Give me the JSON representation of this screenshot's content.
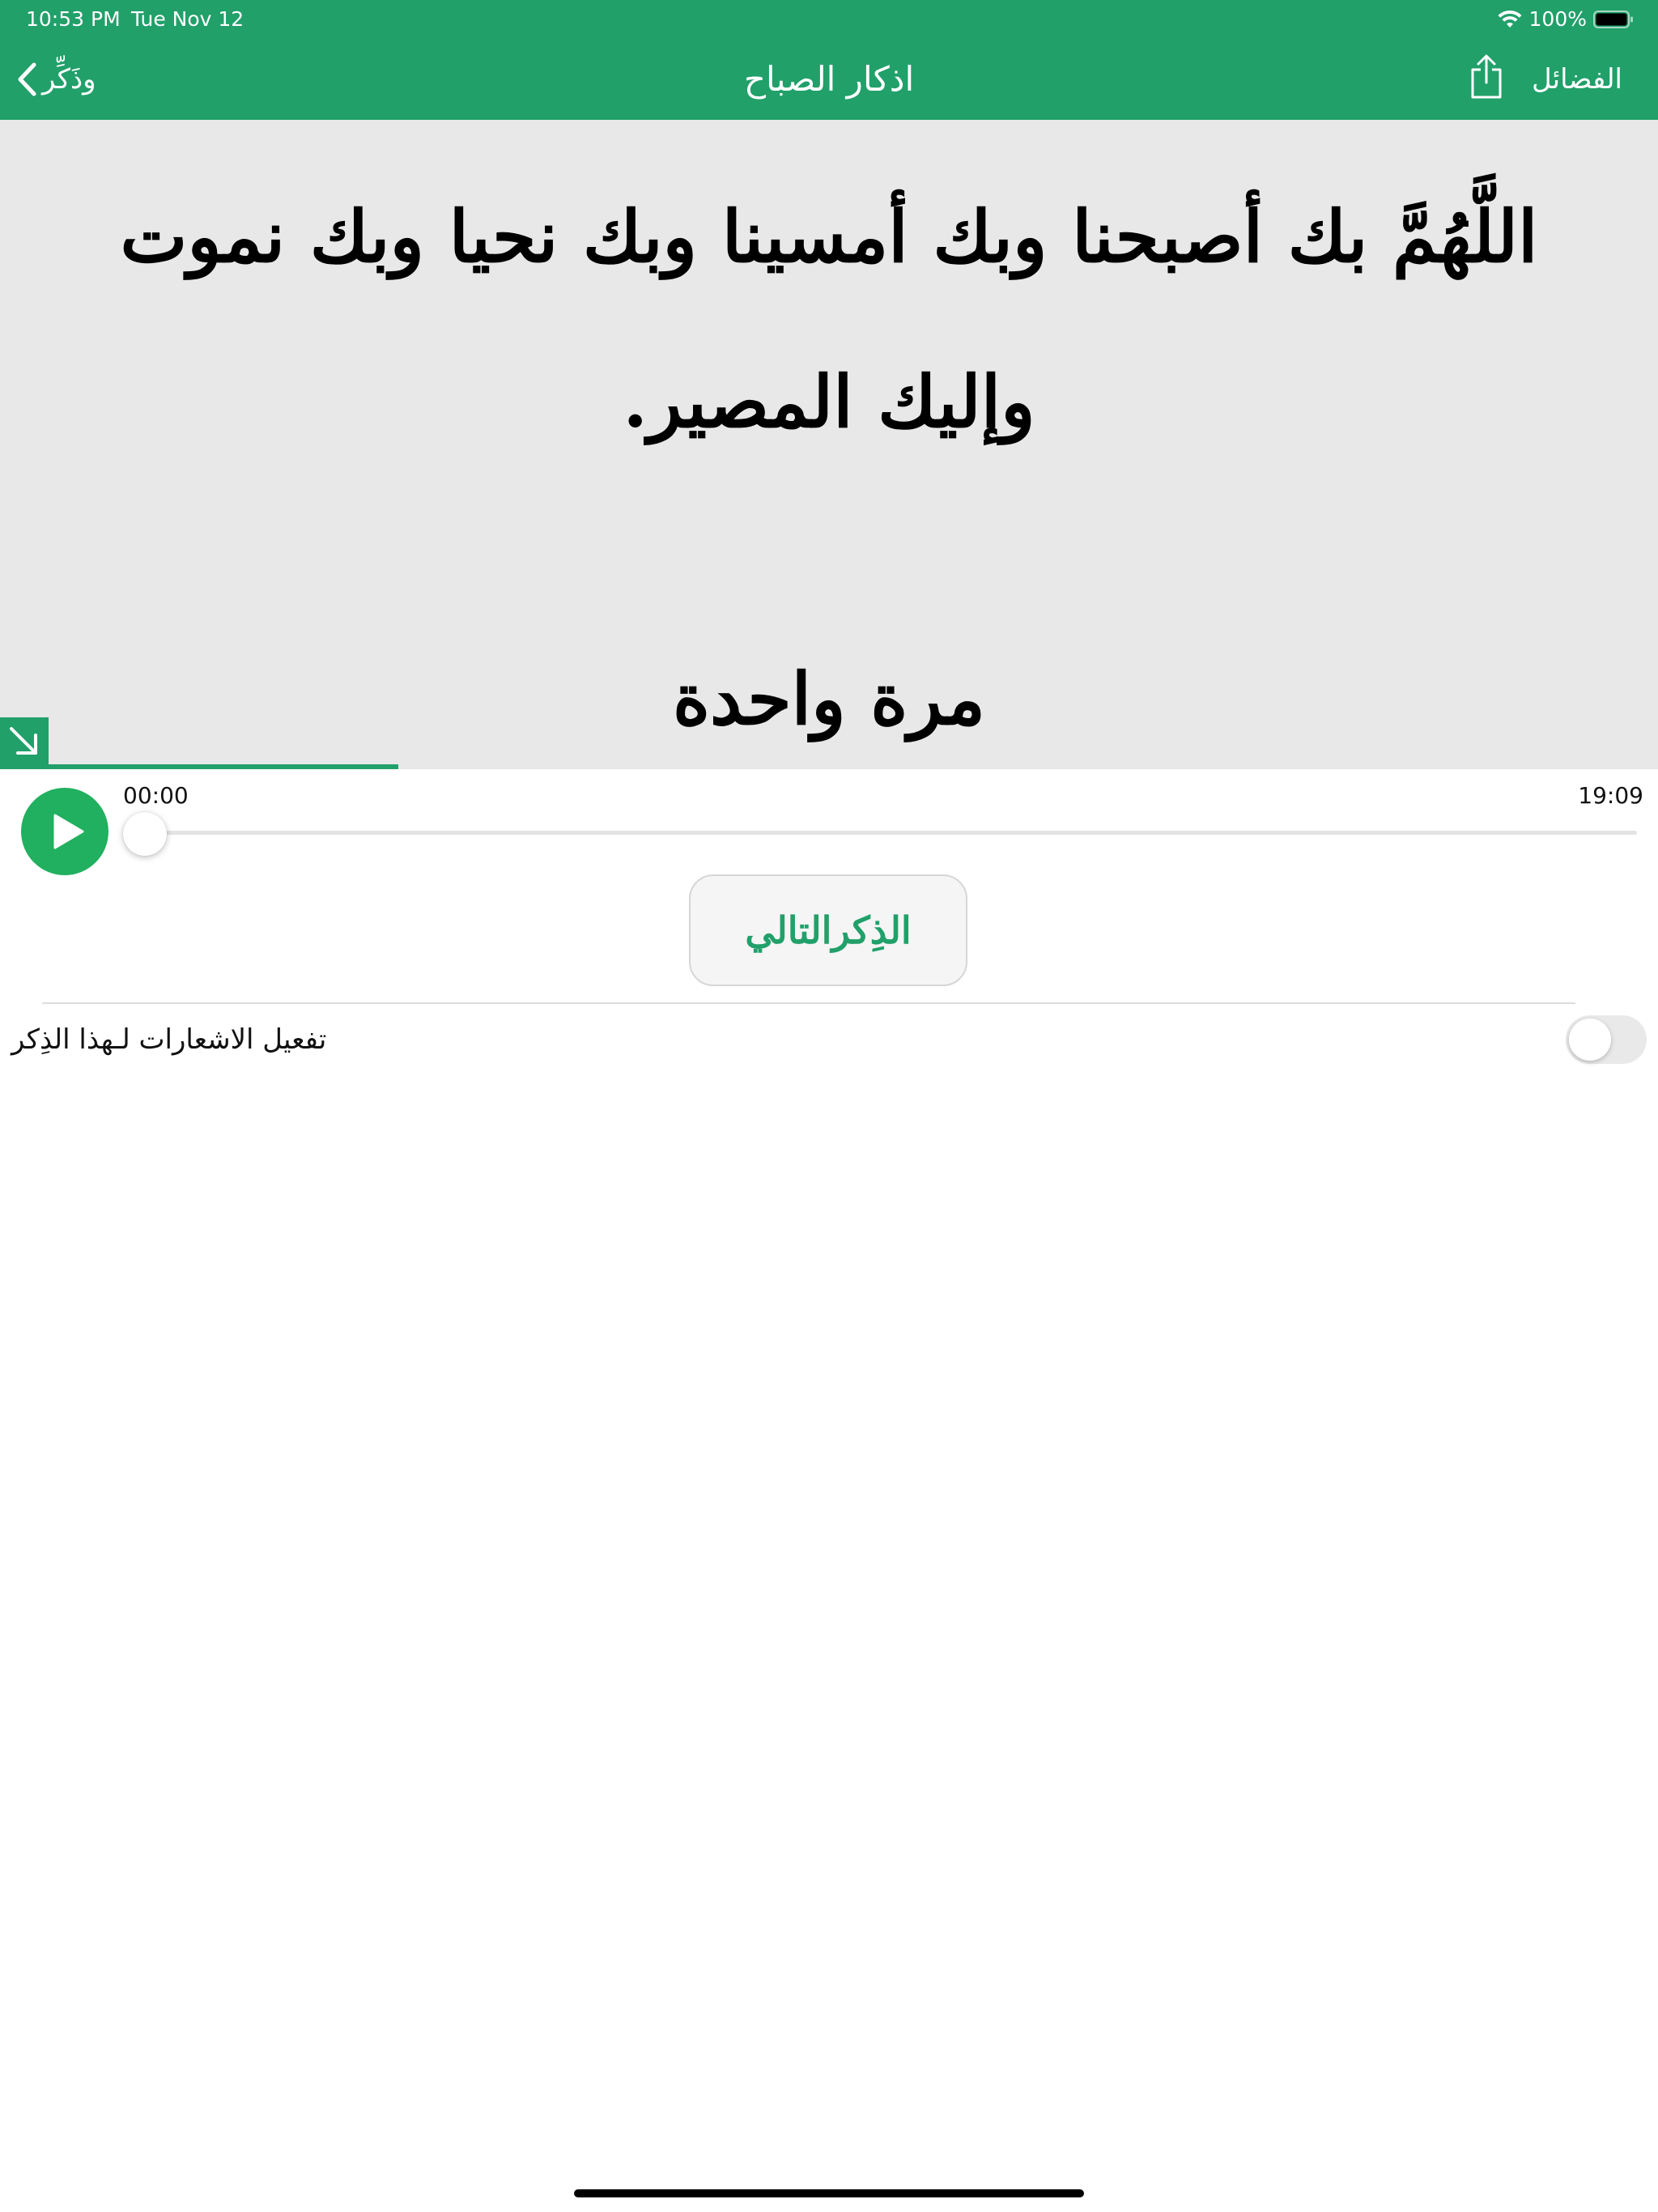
{
  "status_bar": {
    "time": "10:53 PM",
    "date": "Tue Nov 12",
    "battery": "100%",
    "icons": [
      "wifi-icon",
      "battery-icon"
    ]
  },
  "nav": {
    "back_label": "وذَكِّر",
    "title": "اذكار الصباح",
    "virtues_label": "الفضائل",
    "icons": [
      "chevron-left-icon",
      "share-icon"
    ]
  },
  "dhikr": {
    "text": "اللَّهُمَّ بك أصبحنا وبك أمسينا وبك نحيا وبك نموت وإليك المصير.",
    "count": "مرة واحدة",
    "progress": 0.24,
    "expand_icon": "arrow-down-right-icon"
  },
  "player": {
    "current_time": "00:00",
    "total_time": "19:09",
    "position": 0,
    "play_icon": "play-icon"
  },
  "next_button": {
    "label": "الذِكرالتالي"
  },
  "notifications": {
    "label": "تفعيل الاشعارات لـهذا الذِكر",
    "enabled": false
  },
  "colors": {
    "accent": "#21a06a",
    "play_button": "#21b05f",
    "panel_background": "#e8e8e8"
  }
}
